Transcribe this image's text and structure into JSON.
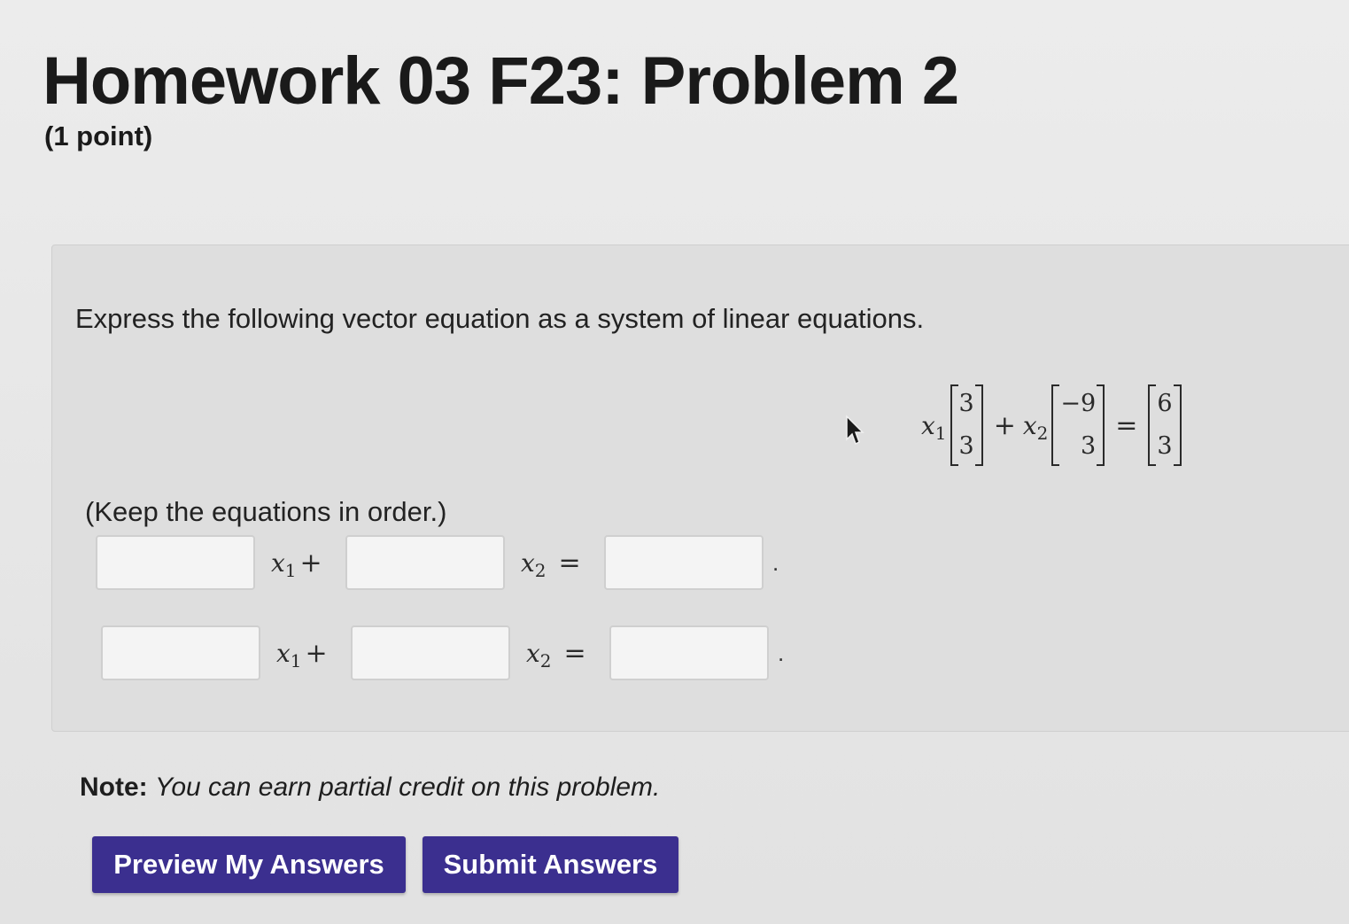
{
  "header": {
    "title": "Homework 03 F23: Problem 2",
    "points": "(1 point)"
  },
  "problem": {
    "instruction": "Express the following vector equation as a system of linear equations.",
    "vector_equation": {
      "var1": "x",
      "var1_sub": "1",
      "var2": "x",
      "var2_sub": "2",
      "plus": "+",
      "equals": "=",
      "vector1": [
        "3",
        "3"
      ],
      "vector2": [
        "−9",
        "3"
      ],
      "rhs": [
        "6",
        "3"
      ]
    },
    "keep_order": "(Keep the equations in order.)",
    "rows": [
      {
        "coef1_value": "",
        "coef2_value": "",
        "rhs_value": "",
        "var1": "x",
        "var1_sub": "1",
        "plus": "+",
        "var2": "x",
        "var2_sub": "2",
        "equals": "=",
        "period": "."
      },
      {
        "coef1_value": "",
        "coef2_value": "",
        "rhs_value": "",
        "var1": "x",
        "var1_sub": "1",
        "plus": "+",
        "var2": "x",
        "var2_sub": "2",
        "equals": "=",
        "period": "."
      }
    ]
  },
  "note": {
    "label": "Note:",
    "text": "You can earn partial credit on this problem."
  },
  "buttons": {
    "preview": "Preview My Answers",
    "submit": "Submit Answers"
  },
  "colors": {
    "button_bg": "#3b2f8f",
    "panel_bg": "#dedede",
    "page_bg": "#e8e8e8"
  },
  "icons": {
    "cursor": "mouse-pointer-icon"
  }
}
